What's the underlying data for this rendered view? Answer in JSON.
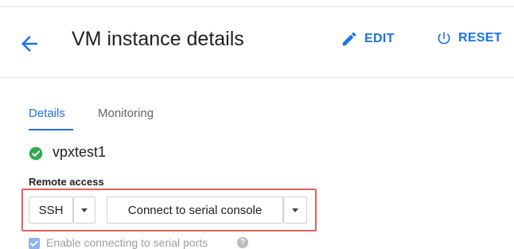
{
  "header": {
    "title": "VM instance details",
    "edit_label": "EDIT",
    "reset_label": "RESET"
  },
  "tabs": [
    {
      "label": "Details",
      "active": true
    },
    {
      "label": "Monitoring",
      "active": false
    }
  ],
  "instance": {
    "name": "vpxtest1",
    "status": "running"
  },
  "remote_access": {
    "label": "Remote access",
    "ssh_label": "SSH",
    "serial_label": "Connect to serial console"
  },
  "serial_ports": {
    "label": "Enable connecting to serial ports",
    "checked": true,
    "help_glyph": "?"
  },
  "icons": {
    "back": "arrow-back-icon",
    "edit": "pencil-icon",
    "reset": "power-icon",
    "status": "check-circle-icon",
    "help": "help-icon"
  },
  "colors": {
    "accent": "#1a73e8",
    "success": "#34a853",
    "highlight": "#e0625a"
  }
}
